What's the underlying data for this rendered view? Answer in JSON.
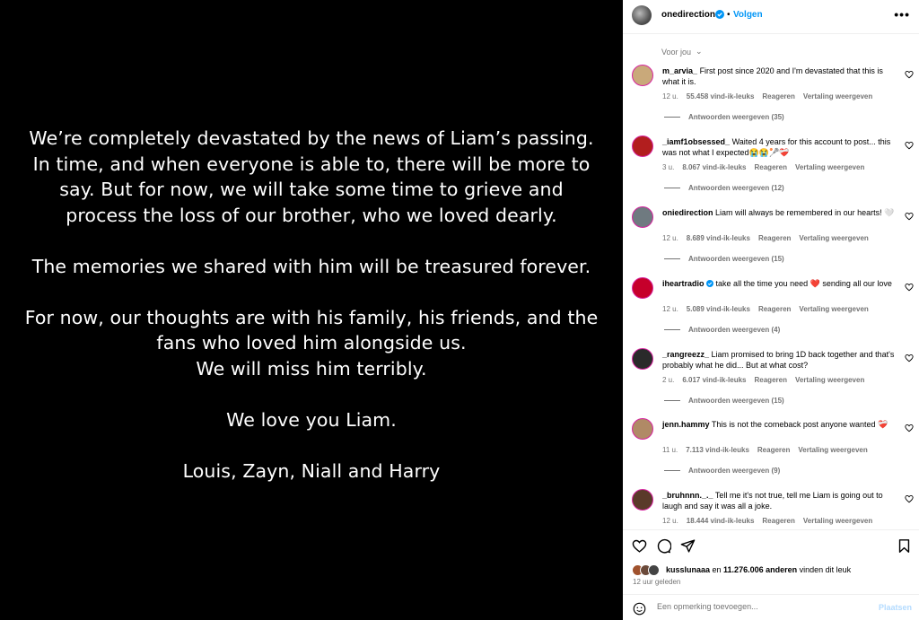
{
  "post": {
    "paragraphs": [
      [
        "We’re completely devastated by the news of Liam’s passing.",
        "In time, and when everyone is able to, there will be more to",
        "say. But for now, we will take some time to grieve and",
        "process the loss of our brother, who we loved dearly."
      ],
      [
        "The memories we shared with him will be treasured forever."
      ],
      [
        "For now, our thoughts are with his family, his friends, and the",
        "fans who loved him alongside us.",
        "We will miss him terribly."
      ],
      [
        "We love you Liam."
      ],
      [
        "Louis, Zayn, Niall and Harry"
      ]
    ]
  },
  "header": {
    "username": "onedirection",
    "separator": "•",
    "follow_label": "Volgen",
    "more_label": "•••"
  },
  "sort": {
    "label": "Voor jou",
    "chevron": "⌄"
  },
  "comments": [
    {
      "user": "m_arvia_",
      "text": "First post since 2020 and I'm devastated that this is what it is.",
      "time": "12 u.",
      "likes": "55.458 vind-ik-leuks",
      "reply": "Reageren",
      "translate": "Vertaling weergeven",
      "replies": "Antwoorden weergeven (35)",
      "verified": false,
      "avatar": "#c9a97a"
    },
    {
      "user": "_iamf1obsessed_",
      "text": "Waited 4 years for this account to post... this was not what I expected😭😭🥍❤️‍🩹",
      "time": "3 u.",
      "likes": "8.067 vind-ik-leuks",
      "reply": "Reageren",
      "translate": "Vertaling weergeven",
      "replies": "Antwoorden weergeven (12)",
      "verified": false,
      "avatar": "#b21e1e"
    },
    {
      "user": "oniedirection",
      "text": "Liam will always be remembered in our hearts! 🤍",
      "time": "12 u.",
      "likes": "8.689 vind-ik-leuks",
      "reply": "Reageren",
      "translate": "Vertaling weergeven",
      "replies": "Antwoorden weergeven (15)",
      "verified": false,
      "avatar": "#6f7a80"
    },
    {
      "user": "iheartradio",
      "text": "take all the time you need ❤️ sending all our love",
      "time": "12 u.",
      "likes": "5.089 vind-ik-leuks",
      "reply": "Reageren",
      "translate": "Vertaling weergeven",
      "replies": "Antwoorden weergeven (4)",
      "verified": true,
      "avatar": "#c6002b"
    },
    {
      "user": "_rangreezz_",
      "text": "Liam promised to bring 1D back together and that's probably what he did... But at what cost?",
      "time": "2 u.",
      "likes": "6.017 vind-ik-leuks",
      "reply": "Reageren",
      "translate": "Vertaling weergeven",
      "replies": "Antwoorden weergeven (15)",
      "verified": false,
      "avatar": "#2a2a2a"
    },
    {
      "user": "jenn.hammy",
      "text": "This is not the comeback post anyone wanted ❤️‍🩹",
      "time": "11 u.",
      "likes": "7.113 vind-ik-leuks",
      "reply": "Reageren",
      "translate": "Vertaling weergeven",
      "replies": "Antwoorden weergeven (9)",
      "verified": false,
      "avatar": "#b08a66"
    },
    {
      "user": "_bruhnnn._._",
      "text": "Tell me it's not true, tell me Liam is going out to laugh and say it was all a joke.",
      "time": "12 u.",
      "likes": "18.444 vind-ik-leuks",
      "reply": "Reageren",
      "translate": "Vertaling weergeven",
      "replies": "",
      "verified": false,
      "avatar": "#5a3a2a"
    }
  ],
  "footer": {
    "likes_user": "kusslunaaa",
    "likes_middle": " en ",
    "likes_count": "11.276.006 anderen",
    "likes_suffix": " vinden dit leuk",
    "time_ago": "12 uur geleden",
    "comment_placeholder": "Een opmerking toevoegen...",
    "post_label": "Plaatsen"
  },
  "colors": {
    "accent": "#0095f6",
    "verified": "#0095f6",
    "muted": "#737373",
    "post_disabled": "#b3dbff"
  }
}
